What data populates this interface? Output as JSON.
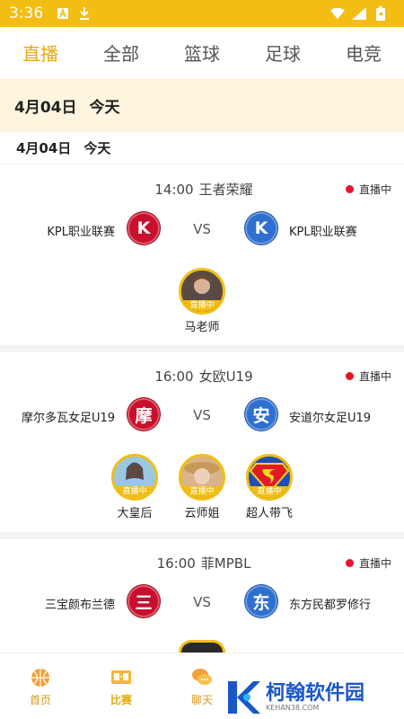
{
  "status_bar": {
    "time": "3:36"
  },
  "tabs": [
    {
      "label": "直播",
      "active": true
    },
    {
      "label": "全部",
      "active": false
    },
    {
      "label": "篮球",
      "active": false
    },
    {
      "label": "足球",
      "active": false
    },
    {
      "label": "电竞",
      "active": false
    }
  ],
  "date_banner": {
    "date": "4月04日",
    "day": "今天"
  },
  "date_sub": {
    "date": "4月04日",
    "day": "今天"
  },
  "matches": [
    {
      "time": "14:00",
      "league": "王者荣耀",
      "status": "直播中",
      "home": {
        "name": "KPL职业联赛",
        "badge": "K",
        "color": "#c8102e"
      },
      "vs": "VS",
      "away": {
        "name": "KPL职业联赛",
        "badge": "K",
        "color": "#2f6fcf"
      },
      "anchors": [
        {
          "name": "马老师",
          "tag": "直播中"
        }
      ]
    },
    {
      "time": "16:00",
      "league": "女欧U19",
      "status": "直播中",
      "home": {
        "name": "摩尔多瓦女足U19",
        "badge": "摩",
        "color": "#c8102e"
      },
      "vs": "VS",
      "away": {
        "name": "安道尔女足U19",
        "badge": "安",
        "color": "#2f6fcf"
      },
      "anchors": [
        {
          "name": "大皇后",
          "tag": "直播中"
        },
        {
          "name": "云师姐",
          "tag": "直播中"
        },
        {
          "name": "超人带飞",
          "tag": "直播中"
        }
      ]
    },
    {
      "time": "16:00",
      "league": "菲MPBL",
      "status": "直播中",
      "home": {
        "name": "三宝颜布兰德",
        "badge": "三",
        "color": "#c8102e"
      },
      "vs": "VS",
      "away": {
        "name": "东方民都罗修行",
        "badge": "东",
        "color": "#2f6fcf"
      }
    }
  ],
  "bottom_nav": [
    {
      "label": "首页",
      "icon": "basketball-home-icon",
      "active": false
    },
    {
      "label": "比赛",
      "icon": "scoreboard-icon",
      "active": true
    },
    {
      "label": "聊天",
      "icon": "chat-bubbles-icon",
      "active": false
    }
  ],
  "watermark": {
    "title": "柯翰软件园",
    "sub": "KEHAN38.COM"
  },
  "colors": {
    "accent": "#f2be14",
    "live_dot": "#e8142a",
    "team_red": "#c8102e",
    "team_blue": "#2f6fcf"
  }
}
